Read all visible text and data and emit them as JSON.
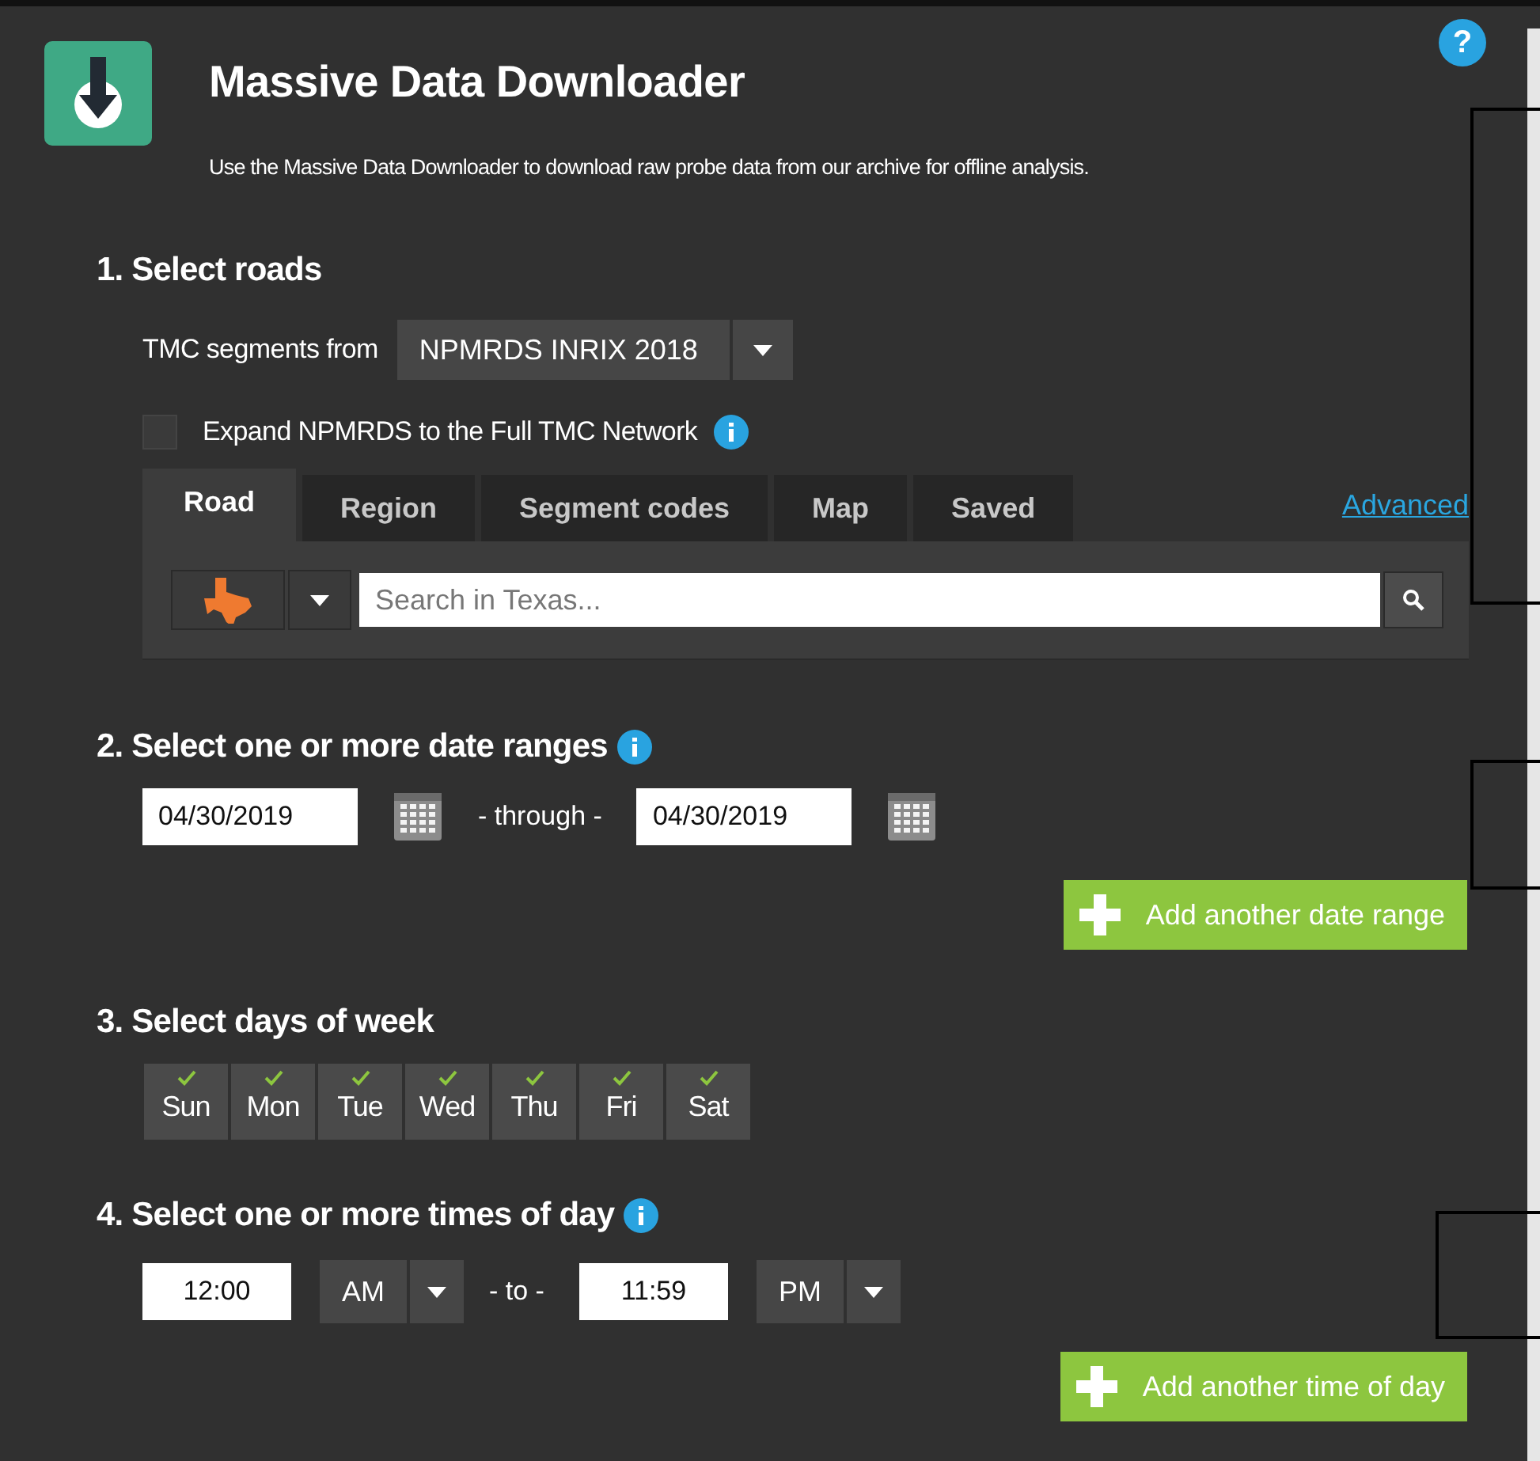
{
  "header": {
    "title": "Massive Data Downloader",
    "description": "Use the Massive Data Downloader to download raw probe data from our archive for offline analysis.",
    "help": "?"
  },
  "roads": {
    "heading": "1. Select roads",
    "source_label": "TMC segments from",
    "source_value": "NPMRDS INRIX 2018",
    "expand": {
      "label": "Expand NPMRDS to the Full TMC Network",
      "checked": false
    },
    "tabs": [
      {
        "label": "Road",
        "selected": true
      },
      {
        "label": "Region",
        "selected": false
      },
      {
        "label": "Segment codes",
        "selected": false
      },
      {
        "label": "Map",
        "selected": false
      },
      {
        "label": "Saved",
        "selected": false
      }
    ],
    "advanced_link": "Advanced",
    "search": {
      "placeholder": "Search in Texas..."
    }
  },
  "dates": {
    "heading": "2. Select one or more date ranges",
    "ranges": [
      {
        "start": "04/30/2019",
        "separator": "- through -",
        "end": "04/30/2019"
      }
    ],
    "add_button": "Add another date range"
  },
  "days": {
    "heading": "3. Select days of week",
    "items": [
      {
        "label": "Sun",
        "checked": true
      },
      {
        "label": "Mon",
        "checked": true
      },
      {
        "label": "Tue",
        "checked": true
      },
      {
        "label": "Wed",
        "checked": true
      },
      {
        "label": "Thu",
        "checked": true
      },
      {
        "label": "Fri",
        "checked": true
      },
      {
        "label": "Sat",
        "checked": true
      }
    ]
  },
  "times": {
    "heading": "4. Select one or more times of day",
    "ranges": [
      {
        "start": "12:00",
        "start_period": "AM",
        "separator": "- to -",
        "end": "11:59",
        "end_period": "PM"
      }
    ],
    "add_button": "Add another time of day"
  }
}
